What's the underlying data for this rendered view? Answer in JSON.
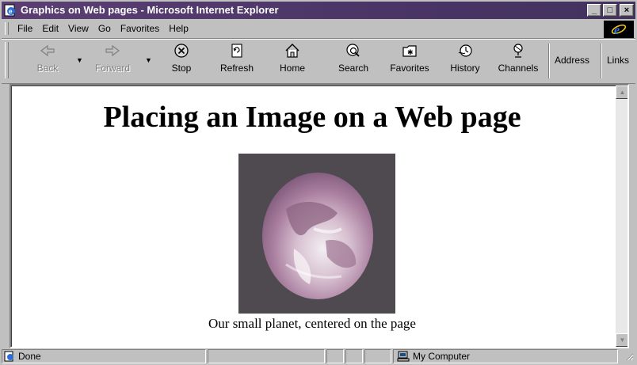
{
  "window": {
    "title": "Graphics on Web pages - Microsoft Internet Explorer",
    "minimize": "_",
    "maximize": "□",
    "close": "×"
  },
  "menu": {
    "items": [
      {
        "label": "File"
      },
      {
        "label": "Edit"
      },
      {
        "label": "View"
      },
      {
        "label": "Go"
      },
      {
        "label": "Favorites"
      },
      {
        "label": "Help"
      }
    ]
  },
  "toolbar": {
    "back": "Back",
    "forward": "Forward",
    "stop": "Stop",
    "refresh": "Refresh",
    "home": "Home",
    "search": "Search",
    "favorites": "Favorites",
    "history": "History",
    "channels": "Channels",
    "address": "Address",
    "links": "Links"
  },
  "page": {
    "heading": "Placing an Image on a Web page",
    "caption": "Our small planet, centered on the page"
  },
  "status": {
    "text": "Done",
    "zone": "My Computer"
  },
  "colors": {
    "titlebar": "#4a3566",
    "chrome": "#c0c0c0"
  }
}
